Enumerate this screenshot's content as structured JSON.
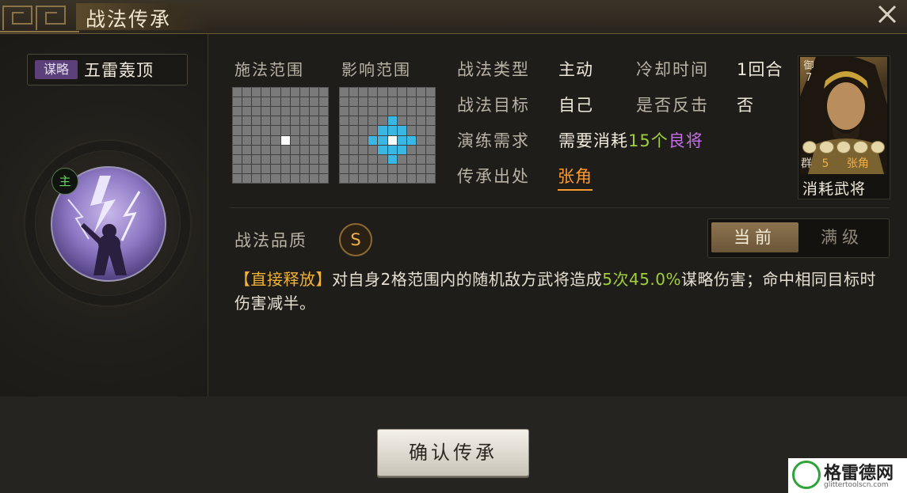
{
  "header": {
    "title": "战法传承",
    "close_icon": "close-icon"
  },
  "skill": {
    "category": "谋略",
    "name": "五雷轰顶",
    "badge": "主",
    "icon": "lightning-strike-icon"
  },
  "range": {
    "cast_label": "施法范围",
    "effect_label": "影响范围"
  },
  "info": {
    "type_label": "战法类型",
    "type_value": "主动",
    "cooldown_label": "冷却时间",
    "cooldown_value": "1回合",
    "target_label": "战法目标",
    "target_value": "自己",
    "counter_label": "是否反击",
    "counter_value": "否",
    "req_label": "演练需求",
    "req_prefix": "需要消耗",
    "req_count": "15个",
    "req_hero_quality": "良将",
    "source_label": "传承出处",
    "source_value": "张角"
  },
  "hero_card": {
    "cost_top": "御",
    "cost_num": "7",
    "faction": "群",
    "cost": "5",
    "name": "张角",
    "stars": 5,
    "label": "消耗武将"
  },
  "quality": {
    "label": "战法品质",
    "grade": "S"
  },
  "tabs": {
    "current": "当前",
    "max": "满级"
  },
  "description": {
    "tag": "【直接释放】",
    "part1": "对自身2格范围内的随机敌方武将造成",
    "times": "5次",
    "pct": "45.0%",
    "part2": "谋略伤害；命中相同目标时伤害减半。"
  },
  "confirm_button": "确认传承",
  "watermark": {
    "text": "格雷德网",
    "url": "glittertoolscn.com"
  }
}
